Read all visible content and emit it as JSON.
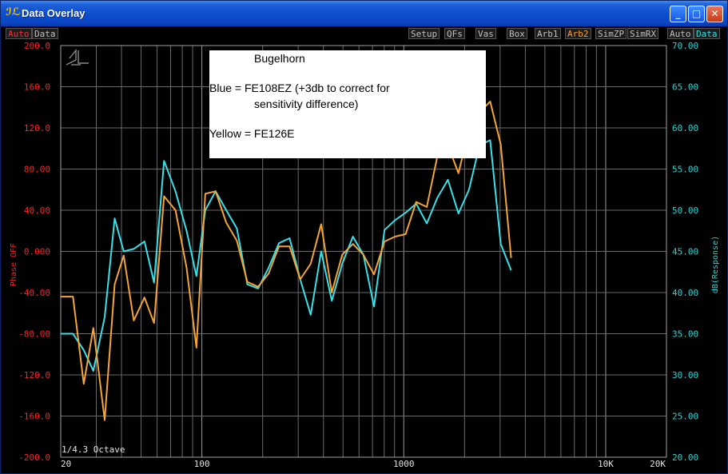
{
  "window": {
    "title": "Data Overlay"
  },
  "toolbar": {
    "left": [
      "Auto",
      "Data"
    ],
    "center": [
      "Setup",
      "QFs",
      "Vas",
      "Box",
      "Arb1",
      "Arb2",
      "SimZP",
      "SimRX"
    ],
    "right": [
      "Auto",
      "Data"
    ]
  },
  "colors": {
    "blue_series": "#38e0e8",
    "yellow_series": "#f5a534",
    "left_axis": "#ff2020",
    "right_axis": "#30d0d0",
    "grid": "#6a6a6a"
  },
  "annotation": {
    "title": "Bugelhorn",
    "line1": "Blue = FE108EZ (+3db to correct for",
    "line2": "sensitivity difference)",
    "line3": "Yellow = FE126E"
  },
  "chart_data": {
    "type": "line",
    "x_scale": "log",
    "xlim": [
      20,
      20000
    ],
    "x_tick_labels": [
      "20",
      "100",
      "1000",
      "10K",
      "20K"
    ],
    "resolution_label": "1/4.3 Octave",
    "left_axis": {
      "label": "Phase OFF",
      "ylim": [
        -200,
        200
      ],
      "ticks": [
        "200.0",
        "160.0",
        "120.0",
        "80.00",
        "40.00",
        "0.000",
        "-40.00",
        "-80.00",
        "-120.0",
        "-160.0",
        "-200.0"
      ]
    },
    "right_axis": {
      "label": "dB(Response)",
      "ylim": [
        20,
        70
      ],
      "ticks": [
        "70.00",
        "65.00",
        "60.00",
        "55.00",
        "50.00",
        "45.00",
        "40.00",
        "35.00",
        "30.00",
        "25.00",
        "20.00"
      ]
    },
    "series": [
      {
        "color": "#38e0e8",
        "points": [
          [
            20,
            35
          ],
          [
            23,
            35
          ],
          [
            26,
            33
          ],
          [
            29,
            30.5
          ],
          [
            33,
            37
          ],
          [
            37,
            49
          ],
          [
            41,
            45
          ],
          [
            46,
            45.3
          ],
          [
            52,
            46.2
          ],
          [
            58,
            41.2
          ],
          [
            65,
            56
          ],
          [
            74,
            52.3
          ],
          [
            84,
            47.5
          ],
          [
            94,
            42
          ],
          [
            104,
            50
          ],
          [
            117,
            52.3
          ],
          [
            132,
            50
          ],
          [
            149,
            47.8
          ],
          [
            168,
            41
          ],
          [
            190,
            40.5
          ],
          [
            214,
            43
          ],
          [
            241,
            46
          ],
          [
            272,
            46.6
          ],
          [
            307,
            41.6
          ],
          [
            346,
            37.3
          ],
          [
            390,
            45
          ],
          [
            440,
            39
          ],
          [
            496,
            43.5
          ],
          [
            560,
            46.8
          ],
          [
            631,
            44.6
          ],
          [
            712,
            38.3
          ],
          [
            803,
            47.6
          ],
          [
            906,
            48.8
          ],
          [
            1021,
            49.7
          ],
          [
            1152,
            50.8
          ],
          [
            1300,
            48.4
          ],
          [
            1466,
            51.5
          ],
          [
            1654,
            53.7
          ],
          [
            1866,
            49.6
          ],
          [
            2105,
            52.5
          ],
          [
            2374,
            57.9
          ],
          [
            2678,
            58.5
          ],
          [
            3021,
            45.9
          ],
          [
            3400,
            42.7
          ]
        ]
      },
      {
        "color": "#f5a534",
        "points": [
          [
            20,
            39.5
          ],
          [
            23,
            39.5
          ],
          [
            26,
            28.9
          ],
          [
            29,
            35.7
          ],
          [
            33,
            24.5
          ],
          [
            37,
            41
          ],
          [
            41,
            44.5
          ],
          [
            46,
            36.6
          ],
          [
            52,
            39.4
          ],
          [
            58,
            36.3
          ],
          [
            65,
            51.7
          ],
          [
            74,
            50
          ],
          [
            84,
            43
          ],
          [
            94,
            33.3
          ],
          [
            104,
            52
          ],
          [
            117,
            52.3
          ],
          [
            132,
            48.5
          ],
          [
            149,
            46.3
          ],
          [
            168,
            41.3
          ],
          [
            190,
            40.7
          ],
          [
            214,
            42.3
          ],
          [
            241,
            45.6
          ],
          [
            272,
            45.6
          ],
          [
            307,
            41.6
          ],
          [
            346,
            43.5
          ],
          [
            390,
            48.3
          ],
          [
            440,
            40
          ],
          [
            496,
            44.6
          ],
          [
            560,
            45.9
          ],
          [
            631,
            44.6
          ],
          [
            712,
            42.2
          ],
          [
            803,
            46.2
          ],
          [
            906,
            46.8
          ],
          [
            1021,
            47.1
          ],
          [
            1152,
            51
          ],
          [
            1300,
            50.4
          ],
          [
            1466,
            56.5
          ],
          [
            1654,
            57.9
          ],
          [
            1866,
            54.5
          ],
          [
            2105,
            59.8
          ],
          [
            2374,
            61.9
          ],
          [
            2678,
            63.2
          ],
          [
            3021,
            58
          ],
          [
            3400,
            44.2
          ]
        ]
      }
    ]
  }
}
